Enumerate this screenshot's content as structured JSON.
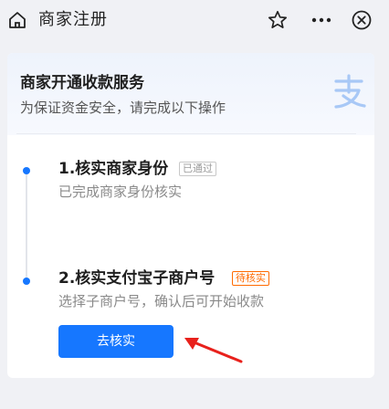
{
  "nav": {
    "title": "商家注册",
    "icons": [
      "home-icon",
      "star-icon",
      "more-icon",
      "close-icon"
    ]
  },
  "card": {
    "title": "商家开通收款服务",
    "subtitle": "为保证资金安全，请完成以下操作",
    "logo": "alipay-logo"
  },
  "steps": [
    {
      "title": "1.核实商家身份",
      "badge": "已通过",
      "desc": "已完成商家身份核实"
    },
    {
      "title": "2.核实支付宝子商户号",
      "badge": "待核实",
      "desc": "选择子商户号，确认后可开始收款"
    }
  ],
  "action": {
    "label": "去核实"
  },
  "colors": {
    "accent": "#1677ff",
    "pending": "#ff6a00",
    "annotation": "#e8211c"
  }
}
